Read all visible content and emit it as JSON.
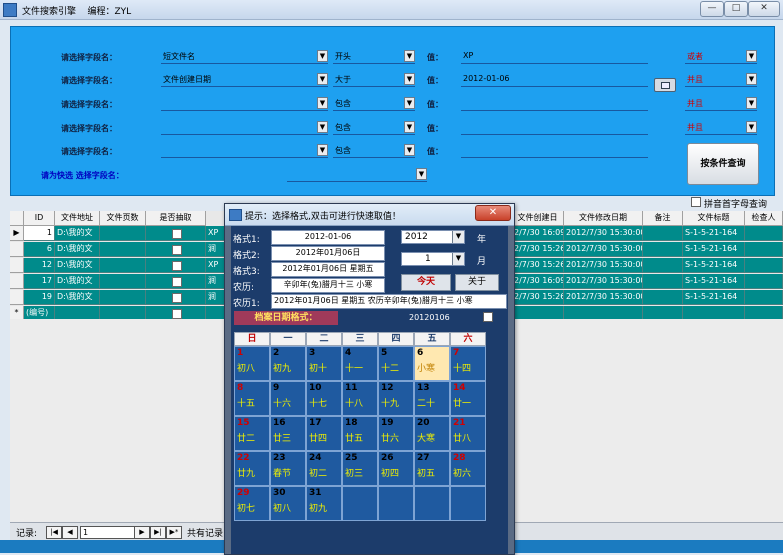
{
  "window": {
    "title": "文件搜索引擎    编程：ZYL",
    "buttons": [
      "—",
      "□",
      "✕"
    ]
  },
  "search": {
    "rows": [
      {
        "label": "请选择字段名：",
        "field": "短文件名",
        "op": "开头",
        "value_label": "值：",
        "value": "XP",
        "logic": "或者"
      },
      {
        "label": "请选择字段名：",
        "field": "文件创建日期",
        "op": "大于",
        "value_label": "值：",
        "value": "2012-01-06",
        "logic": "并且"
      },
      {
        "label": "请选择字段名：",
        "field": "",
        "op": "包含",
        "value_label": "值：",
        "value": "",
        "logic": "并且"
      },
      {
        "label": "请选择字段名：",
        "field": "",
        "op": "包含",
        "value_label": "值：",
        "value": "",
        "logic": "并且"
      },
      {
        "label": "请选择字段名：",
        "field": "",
        "op": "包含",
        "value_label": "值：",
        "value": "",
        "logic": ""
      }
    ],
    "quick_pick_label": "请为快选 选择字段名：",
    "search_button": "按条件查询",
    "pinyin_label": "拼音首字母查询"
  },
  "grid": {
    "headers": [
      "ID",
      "文件地址",
      "文件页数",
      "是否抽取",
      "文件创建日",
      "文件修改日期",
      "备注",
      "文件标题",
      "检查人"
    ],
    "rows": [
      {
        "marker": "▶",
        "id": "1",
        "path": "D:\\我的文",
        "created": "2/7/30 16:09:00",
        "modified": "2012/7/30 15:30:00",
        "title": "S-1-5-21-164",
        "extra": "XP"
      },
      {
        "marker": "",
        "id": "6",
        "path": "D:\\我的文",
        "created": "2/7/30 15:26:00",
        "modified": "2012/7/30 15:30:00",
        "title": "S-1-5-21-164",
        "extra": "涧"
      },
      {
        "marker": "",
        "id": "12",
        "path": "D:\\我的文",
        "created": "2/7/30 15:26:00",
        "modified": "2012/7/30 15:30:00",
        "title": "S-1-5-21-164",
        "extra": "XP"
      },
      {
        "marker": "",
        "id": "17",
        "path": "D:\\我的文",
        "created": "2/7/30 16:09:00",
        "modified": "2012/7/30 15:30:00",
        "title": "S-1-5-21-164",
        "extra": "涧"
      },
      {
        "marker": "",
        "id": "19",
        "path": "D:\\我的文",
        "created": "2/7/30 15:26:00",
        "modified": "2012/7/30 15:30:00",
        "title": "S-1-5-21-164",
        "extra": "涧"
      }
    ],
    "new_row": {
      "marker": "*",
      "id": "(编号)"
    }
  },
  "record_nav": {
    "label": "记录:",
    "value": "1",
    "total_label": "共有记录"
  },
  "popup": {
    "title": "提示：选择格式,双击可进行快速取值！",
    "close": "✕",
    "formats": [
      {
        "label": "格式1:",
        "value": "2012-01-06"
      },
      {
        "label": "格式2:",
        "value": "2012年01月06日"
      },
      {
        "label": "格式3:",
        "value": "2012年01月06日 星期五"
      },
      {
        "label": "农历:",
        "value": "辛卯年(兔)腊月十三 小寒"
      },
      {
        "label": "农历1:",
        "value": "2012年01月06日 星期五 农历辛卯年(兔)腊月十三 小寒"
      }
    ],
    "year": "2012",
    "year_unit": "年",
    "month": "1",
    "month_unit": "月",
    "today_button": "今天",
    "about_button": "关于",
    "archive_label": "档案日期格式：",
    "archive_value": "20120106",
    "weekdays": [
      "日",
      "一",
      "二",
      "三",
      "四",
      "五",
      "六"
    ],
    "days": [
      {
        "d": "1",
        "l": "初八"
      },
      {
        "d": "2",
        "l": "初九"
      },
      {
        "d": "3",
        "l": "初十"
      },
      {
        "d": "4",
        "l": "十一"
      },
      {
        "d": "5",
        "l": "十二"
      },
      {
        "d": "6",
        "l": "小寒"
      },
      {
        "d": "7",
        "l": "十四"
      },
      {
        "d": "8",
        "l": "十五"
      },
      {
        "d": "9",
        "l": "十六"
      },
      {
        "d": "10",
        "l": "十七"
      },
      {
        "d": "11",
        "l": "十八"
      },
      {
        "d": "12",
        "l": "十九"
      },
      {
        "d": "13",
        "l": "二十"
      },
      {
        "d": "14",
        "l": "廿一"
      },
      {
        "d": "15",
        "l": "廿二"
      },
      {
        "d": "16",
        "l": "廿三"
      },
      {
        "d": "17",
        "l": "廿四"
      },
      {
        "d": "18",
        "l": "廿五"
      },
      {
        "d": "19",
        "l": "廿六"
      },
      {
        "d": "20",
        "l": "大寒"
      },
      {
        "d": "21",
        "l": "廿八"
      },
      {
        "d": "22",
        "l": "廿九"
      },
      {
        "d": "23",
        "l": "春节"
      },
      {
        "d": "24",
        "l": "初二"
      },
      {
        "d": "25",
        "l": "初三"
      },
      {
        "d": "26",
        "l": "初四"
      },
      {
        "d": "27",
        "l": "初五"
      },
      {
        "d": "28",
        "l": "初六"
      },
      {
        "d": "29",
        "l": "初七"
      },
      {
        "d": "30",
        "l": "初八"
      },
      {
        "d": "31",
        "l": "初九"
      }
    ]
  }
}
